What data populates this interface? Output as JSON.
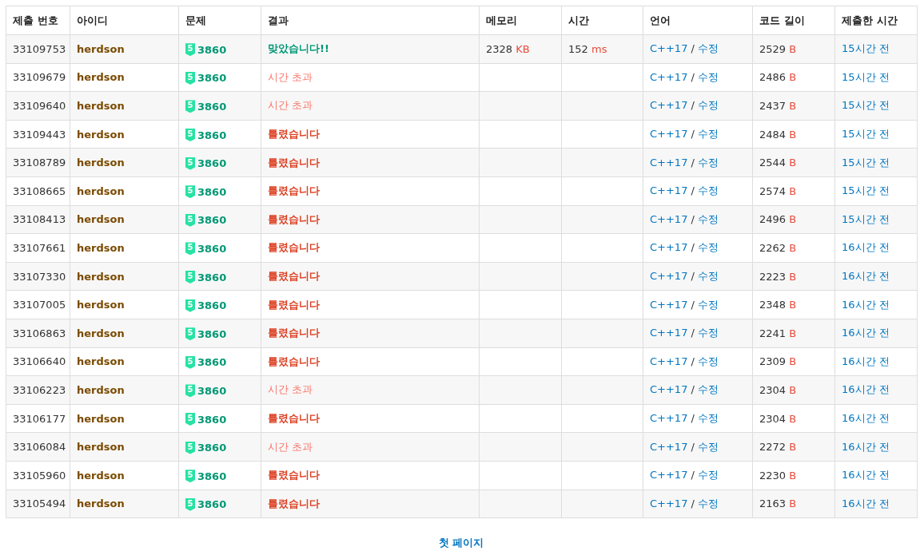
{
  "table": {
    "columns": [
      "제출 번호",
      "아이디",
      "문제",
      "결과",
      "메모리",
      "시간",
      "언어",
      "코드 길이",
      "제출한 시간"
    ],
    "rows": [
      {
        "id": "33109753",
        "user": "herdson",
        "problem": {
          "tier": "5",
          "number": "3860"
        },
        "result": {
          "kind": "accepted",
          "text": "맞았습니다!!"
        },
        "memory": {
          "value": "2328",
          "unit": "KB"
        },
        "time": {
          "value": "152",
          "unit": "ms"
        },
        "language": "C++17",
        "separator": "/",
        "edit": "수정",
        "code_length": {
          "value": "2529",
          "unit": "B"
        },
        "submitted": "15시간 전"
      },
      {
        "id": "33109679",
        "user": "herdson",
        "problem": {
          "tier": "5",
          "number": "3860"
        },
        "result": {
          "kind": "timeout",
          "text": "시간 초과"
        },
        "language": "C++17",
        "separator": "/",
        "edit": "수정",
        "code_length": {
          "value": "2486",
          "unit": "B"
        },
        "submitted": "15시간 전"
      },
      {
        "id": "33109640",
        "user": "herdson",
        "problem": {
          "tier": "5",
          "number": "3860"
        },
        "result": {
          "kind": "timeout",
          "text": "시간 초과"
        },
        "language": "C++17",
        "separator": "/",
        "edit": "수정",
        "code_length": {
          "value": "2437",
          "unit": "B"
        },
        "submitted": "15시간 전"
      },
      {
        "id": "33109443",
        "user": "herdson",
        "problem": {
          "tier": "5",
          "number": "3860"
        },
        "result": {
          "kind": "wrong",
          "text": "틀렸습니다"
        },
        "language": "C++17",
        "separator": "/",
        "edit": "수정",
        "code_length": {
          "value": "2484",
          "unit": "B"
        },
        "submitted": "15시간 전"
      },
      {
        "id": "33108789",
        "user": "herdson",
        "problem": {
          "tier": "5",
          "number": "3860"
        },
        "result": {
          "kind": "wrong",
          "text": "틀렸습니다"
        },
        "language": "C++17",
        "separator": "/",
        "edit": "수정",
        "code_length": {
          "value": "2544",
          "unit": "B"
        },
        "submitted": "15시간 전"
      },
      {
        "id": "33108665",
        "user": "herdson",
        "problem": {
          "tier": "5",
          "number": "3860"
        },
        "result": {
          "kind": "wrong",
          "text": "틀렸습니다"
        },
        "language": "C++17",
        "separator": "/",
        "edit": "수정",
        "code_length": {
          "value": "2574",
          "unit": "B"
        },
        "submitted": "15시간 전"
      },
      {
        "id": "33108413",
        "user": "herdson",
        "problem": {
          "tier": "5",
          "number": "3860"
        },
        "result": {
          "kind": "wrong",
          "text": "틀렸습니다"
        },
        "language": "C++17",
        "separator": "/",
        "edit": "수정",
        "code_length": {
          "value": "2496",
          "unit": "B"
        },
        "submitted": "15시간 전"
      },
      {
        "id": "33107661",
        "user": "herdson",
        "problem": {
          "tier": "5",
          "number": "3860"
        },
        "result": {
          "kind": "wrong",
          "text": "틀렸습니다"
        },
        "language": "C++17",
        "separator": "/",
        "edit": "수정",
        "code_length": {
          "value": "2262",
          "unit": "B"
        },
        "submitted": "16시간 전"
      },
      {
        "id": "33107330",
        "user": "herdson",
        "problem": {
          "tier": "5",
          "number": "3860"
        },
        "result": {
          "kind": "wrong",
          "text": "틀렸습니다"
        },
        "language": "C++17",
        "separator": "/",
        "edit": "수정",
        "code_length": {
          "value": "2223",
          "unit": "B"
        },
        "submitted": "16시간 전"
      },
      {
        "id": "33107005",
        "user": "herdson",
        "problem": {
          "tier": "5",
          "number": "3860"
        },
        "result": {
          "kind": "wrong",
          "text": "틀렸습니다"
        },
        "language": "C++17",
        "separator": "/",
        "edit": "수정",
        "code_length": {
          "value": "2348",
          "unit": "B"
        },
        "submitted": "16시간 전"
      },
      {
        "id": "33106863",
        "user": "herdson",
        "problem": {
          "tier": "5",
          "number": "3860"
        },
        "result": {
          "kind": "wrong",
          "text": "틀렸습니다"
        },
        "language": "C++17",
        "separator": "/",
        "edit": "수정",
        "code_length": {
          "value": "2241",
          "unit": "B"
        },
        "submitted": "16시간 전"
      },
      {
        "id": "33106640",
        "user": "herdson",
        "problem": {
          "tier": "5",
          "number": "3860"
        },
        "result": {
          "kind": "wrong",
          "text": "틀렸습니다"
        },
        "language": "C++17",
        "separator": "/",
        "edit": "수정",
        "code_length": {
          "value": "2309",
          "unit": "B"
        },
        "submitted": "16시간 전"
      },
      {
        "id": "33106223",
        "user": "herdson",
        "problem": {
          "tier": "5",
          "number": "3860"
        },
        "result": {
          "kind": "timeout",
          "text": "시간 초과"
        },
        "language": "C++17",
        "separator": "/",
        "edit": "수정",
        "code_length": {
          "value": "2304",
          "unit": "B"
        },
        "submitted": "16시간 전"
      },
      {
        "id": "33106177",
        "user": "herdson",
        "problem": {
          "tier": "5",
          "number": "3860"
        },
        "result": {
          "kind": "wrong",
          "text": "틀렸습니다"
        },
        "language": "C++17",
        "separator": "/",
        "edit": "수정",
        "code_length": {
          "value": "2304",
          "unit": "B"
        },
        "submitted": "16시간 전"
      },
      {
        "id": "33106084",
        "user": "herdson",
        "problem": {
          "tier": "5",
          "number": "3860"
        },
        "result": {
          "kind": "timeout",
          "text": "시간 초과"
        },
        "language": "C++17",
        "separator": "/",
        "edit": "수정",
        "code_length": {
          "value": "2272",
          "unit": "B"
        },
        "submitted": "16시간 전"
      },
      {
        "id": "33105960",
        "user": "herdson",
        "problem": {
          "tier": "5",
          "number": "3860"
        },
        "result": {
          "kind": "wrong",
          "text": "틀렸습니다"
        },
        "language": "C++17",
        "separator": "/",
        "edit": "수정",
        "code_length": {
          "value": "2230",
          "unit": "B"
        },
        "submitted": "16시간 전"
      },
      {
        "id": "33105494",
        "user": "herdson",
        "problem": {
          "tier": "5",
          "number": "3860"
        },
        "result": {
          "kind": "wrong",
          "text": "틀렸습니다"
        },
        "language": "C++17",
        "separator": "/",
        "edit": "수정",
        "code_length": {
          "value": "2163",
          "unit": "B"
        },
        "submitted": "16시간 전"
      }
    ]
  },
  "pagination": {
    "first_page": "첫 페이지"
  }
}
